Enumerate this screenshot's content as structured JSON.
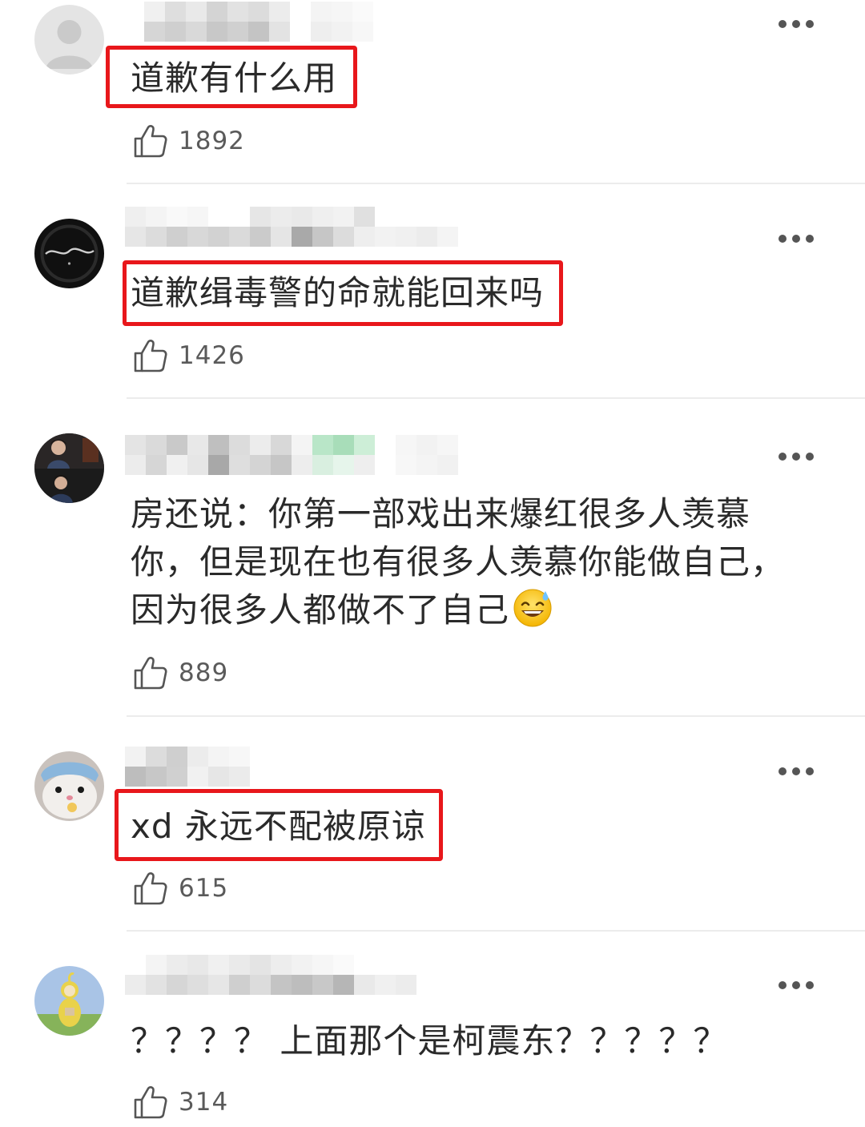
{
  "comments": [
    {
      "text": "道歉有什么用",
      "likes": "1892",
      "avatar_icon": "default-user-avatar-icon",
      "highlighted": true
    },
    {
      "text": "道歉缉毒警的命就能回来吗",
      "likes": "1426",
      "avatar_icon": "dark-logo-avatar-icon",
      "highlighted": true
    },
    {
      "text_lines": [
        "房还说：你第一部戏出来爆红很多人羡慕",
        "你，但是现在也有很多人羡慕你能做自己，",
        "因为很多人都做不了自己"
      ],
      "likes": "889",
      "avatar_icon": "photo-avatar-icon",
      "emoji": "sweat-smile-emoji-icon",
      "highlighted": false
    },
    {
      "text": "xd 永远不配被原谅",
      "likes": "615",
      "avatar_icon": "hamster-avatar-icon",
      "highlighted": true
    },
    {
      "text": "？？？？ 上面那个是柯震东？？？？？",
      "likes": "314",
      "avatar_icon": "teletubby-avatar-icon",
      "highlighted": false
    }
  ],
  "colors": {
    "highlight": "#e8171b",
    "divider": "#ececec",
    "text": "#2a2a2a",
    "like_count": "#5a5a5a"
  },
  "icons": {
    "more": "more-dots-icon",
    "like": "thumbs-up-icon"
  }
}
